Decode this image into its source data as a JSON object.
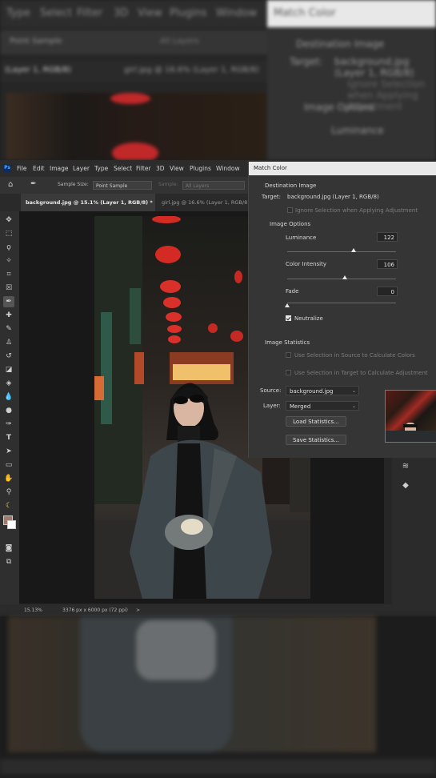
{
  "background_blur_top": {
    "menu_items": [
      "Type",
      "Select",
      "Filter",
      "3D",
      "View",
      "Plugins",
      "Window"
    ],
    "option_select": "Point Sample",
    "option_extra": "All Layers",
    "tabs": [
      "(Layer 1, RGB/8)",
      "girl.jpg @ 16.6% (Layer 1, RGB/8)"
    ],
    "dialog_title": "Match Color",
    "dialog_lines": [
      "Destination Image",
      "Target:",
      "background.jpg (Layer 1, RGB/8)",
      "Ignore Selection when Applying Adjustment",
      "Image Options",
      "Luminance"
    ]
  },
  "menubar": {
    "app_icon": "Ps",
    "items": [
      "File",
      "Edit",
      "Image",
      "Layer",
      "Type",
      "Select",
      "Filter",
      "3D",
      "View",
      "Plugins",
      "Window"
    ]
  },
  "options_bar": {
    "sample_size_label": "Sample Size:",
    "sample_size_value": "Point Sample",
    "sample_label": "Sample:",
    "sample_value": "All Layers"
  },
  "tabs": [
    {
      "label": "background.jpg @ 15.1% (Layer 1, RGB/8) *",
      "active": true
    },
    {
      "label": "girl.jpg @ 16.6% (Layer 1, RGB/8)",
      "active": false
    }
  ],
  "status_bar": {
    "zoom": "15.13%",
    "doc_size": "3376 px x 6000 px (72 ppi)",
    "arrow": ">"
  },
  "match_color": {
    "title": "Match Color",
    "destination_header": "Destination Image",
    "target_label": "Target:",
    "target_value": "background.jpg (Layer 1, RGB/8)",
    "ignore_selection": "Ignore Selection when Applying Adjustment",
    "image_options_header": "Image Options",
    "luminance_label": "Luminance",
    "luminance_value": "122",
    "luminance_level": 0.61,
    "color_intensity_label": "Color Intensity",
    "color_intensity_value": "106",
    "color_intensity_level": 0.53,
    "fade_label": "Fade",
    "fade_value": "0",
    "fade_level": 0.0,
    "neutralize_label": "Neutralize",
    "neutralize_checked": true,
    "image_statistics_header": "Image Statistics",
    "use_sel_source": "Use Selection in Source to Calculate Colors",
    "use_sel_target": "Use Selection in Target to Calculate Adjustment",
    "source_label": "Source:",
    "source_value": "background.jpg",
    "layer_label": "Layer:",
    "layer_value": "Merged",
    "load_button": "Load Statistics...",
    "save_button": "Save Statistics..."
  },
  "icons": {
    "home": "home-icon",
    "eyedropper": "eyedropper-icon",
    "adjust": "sliders-icon",
    "layers": "layers-icon"
  }
}
